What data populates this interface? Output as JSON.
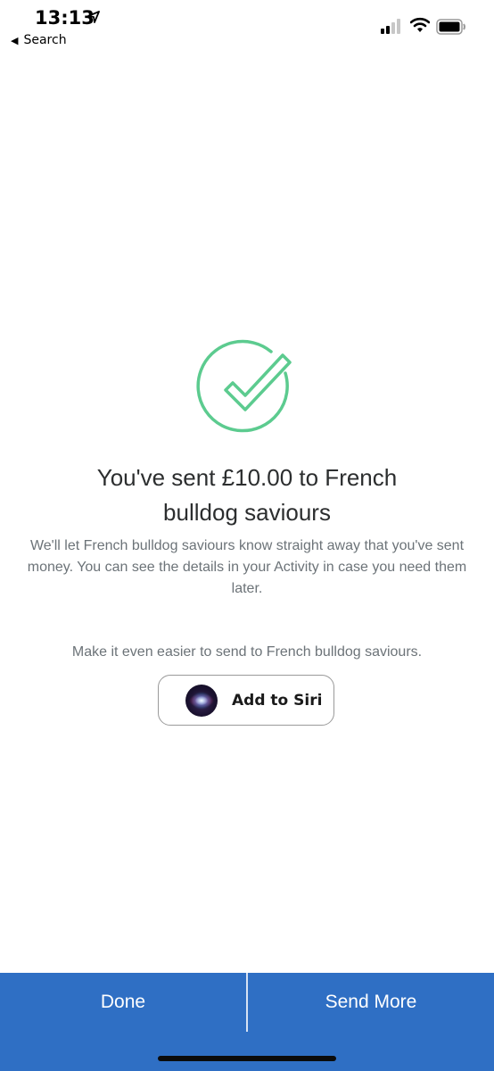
{
  "status_bar": {
    "time": "13:13",
    "back_label": "Search"
  },
  "confirmation": {
    "title": "You've sent £10.00 to French bulldog saviours",
    "description": "We'll let French bulldog saviours know straight away that you've sent money. You can see the details in your Activity in case you need them later."
  },
  "siri": {
    "prompt": "Make it even easier to send to French bulldog saviours.",
    "button_label": "Add to Siri"
  },
  "actions": {
    "done_label": "Done",
    "send_more_label": "Send More"
  },
  "colors": {
    "success_green": "#5ccb8f",
    "bottom_bar_blue": "#2f6fc4"
  },
  "icons": [
    "location-arrow-icon",
    "back-triangle-icon",
    "signal-icon",
    "wifi-icon",
    "battery-icon",
    "success-check-icon",
    "siri-orb-icon"
  ]
}
